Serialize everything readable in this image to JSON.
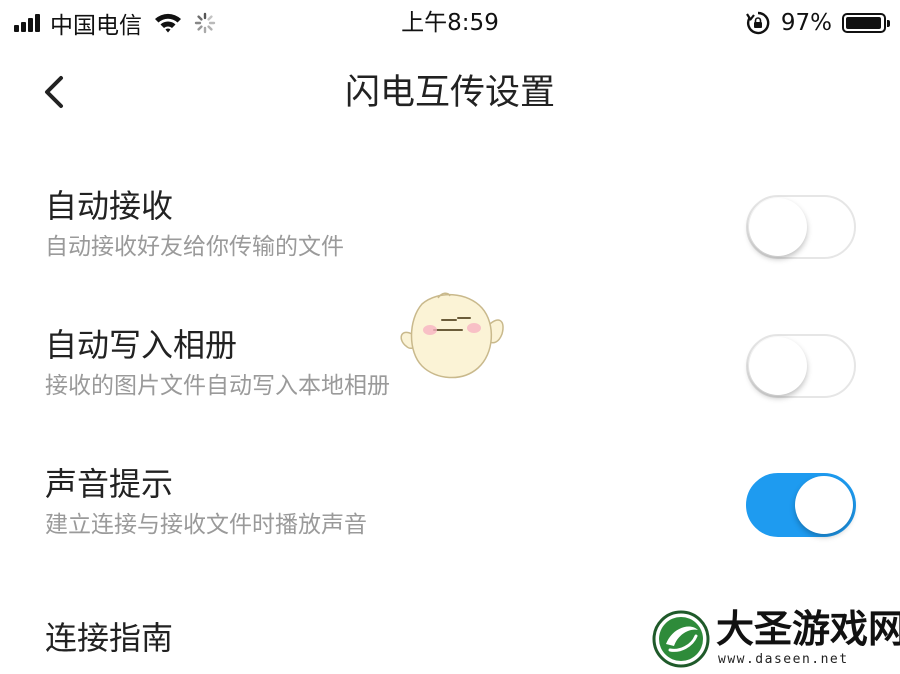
{
  "status_bar": {
    "carrier": "中国电信",
    "time": "上午8:59",
    "battery_percent": "97%",
    "battery_level": 0.97,
    "icons": [
      "signal-bars-icon",
      "wifi-icon",
      "loading-spinner-icon",
      "rotation-lock-icon",
      "battery-icon"
    ]
  },
  "nav": {
    "back_icon": "chevron-left-icon",
    "title": "闪电互传设置"
  },
  "settings": [
    {
      "title": "自动接收",
      "description": "自动接收好友给你传输的文件",
      "toggle_on": false
    },
    {
      "title": "自动写入相册",
      "description": "接收的图片文件自动写入本地相册",
      "toggle_on": false
    },
    {
      "title": "声音提示",
      "description": "建立连接与接收文件时播放声音",
      "toggle_on": true
    },
    {
      "title": "连接指南"
    }
  ],
  "colors": {
    "accent": "#1e9bf0",
    "text_primary": "#222222",
    "text_secondary": "#9a9a9a",
    "toggle_off_border": "#e6e6e6"
  },
  "watermark": {
    "name": "大圣游戏网",
    "url": "www.daseen.net"
  }
}
